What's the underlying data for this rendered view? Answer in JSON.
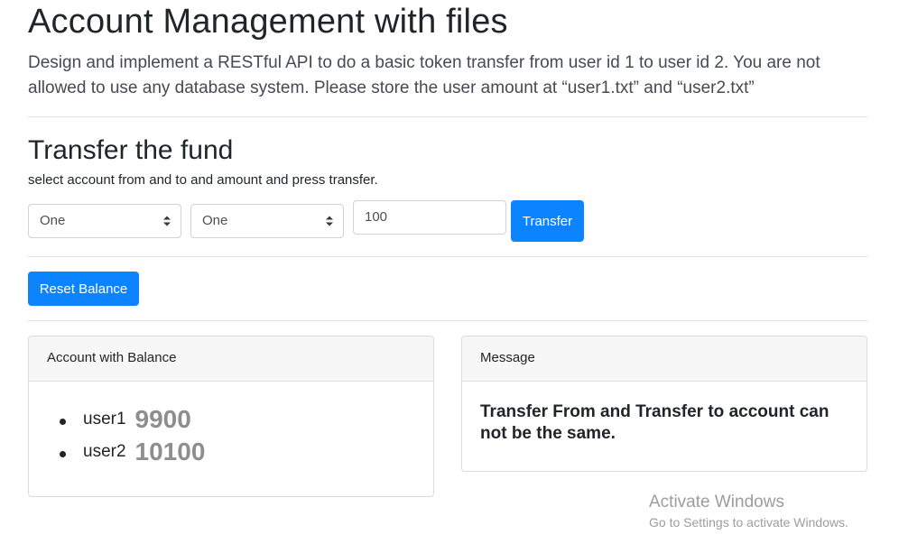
{
  "header": {
    "title": "Account Management with files",
    "description": "Design and implement a RESTful API to do a basic token transfer from user id 1 to user id 2. You are not allowed to use any database system. Please store the user amount at “user1.txt” and “user2.txt”"
  },
  "transfer": {
    "heading": "Transfer the fund",
    "instructions": "select account from and to and amount and press transfer.",
    "from_value": "One",
    "to_value": "One",
    "amount_value": "100",
    "button_label": "Transfer"
  },
  "reset": {
    "button_label": "Reset Balance"
  },
  "balances": {
    "header": "Account with Balance",
    "accounts": [
      {
        "name": "user1",
        "amount": "9900"
      },
      {
        "name": "user2",
        "amount": "10100"
      }
    ]
  },
  "message": {
    "header": "Message",
    "text": "Transfer From and Transfer to account can not be the same."
  },
  "watermark": {
    "title": "Activate Windows",
    "subtitle": "Go to Settings to activate Windows."
  },
  "colors": {
    "primary": "#0d84ff",
    "amount": "#8e8e8e",
    "card_header_bg": "#f7f7f7"
  },
  "icons": [
    "select-caret-icon",
    "bullet-dot-icon"
  ]
}
